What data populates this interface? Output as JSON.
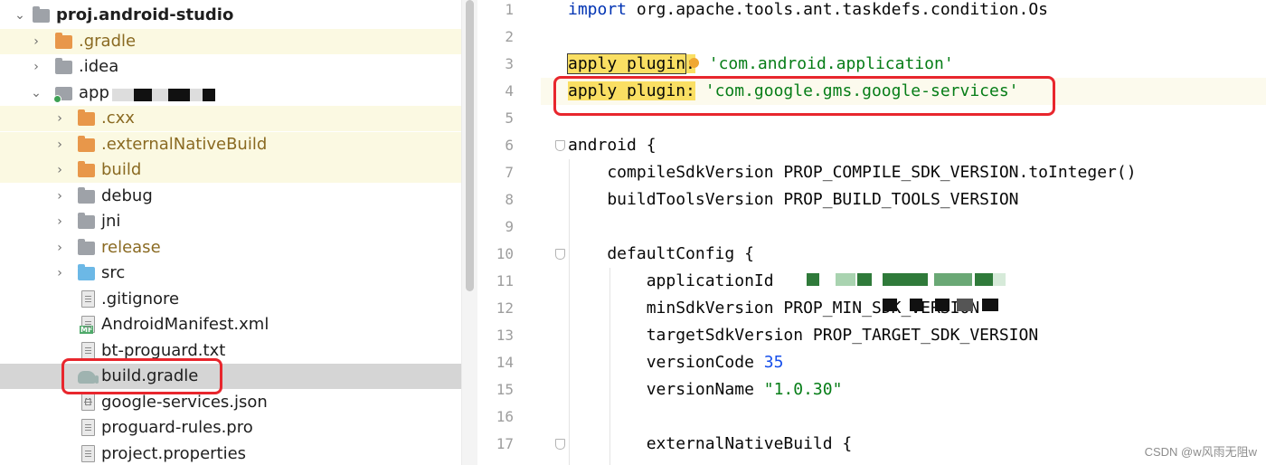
{
  "project_tree": {
    "root": "proj.android-studio",
    "items": [
      {
        "label": ".gradle",
        "expanded": false
      },
      {
        "label": ".idea",
        "expanded": false
      },
      {
        "label": "app",
        "expanded": true
      },
      {
        "label": ".cxx",
        "expanded": false
      },
      {
        "label": ".externalNativeBuild",
        "expanded": false
      },
      {
        "label": "build",
        "expanded": false
      },
      {
        "label": "debug",
        "expanded": false
      },
      {
        "label": "jni",
        "expanded": false
      },
      {
        "label": "release",
        "expanded": false
      },
      {
        "label": "src",
        "expanded": false
      },
      {
        "label": ".gitignore"
      },
      {
        "label": "AndroidManifest.xml",
        "badge": "MF"
      },
      {
        "label": "bt-proguard.txt"
      },
      {
        "label": "build.gradle",
        "selected": true
      },
      {
        "label": "google-services.json",
        "badge": "{}"
      },
      {
        "label": "proguard-rules.pro"
      },
      {
        "label": "project.properties"
      }
    ]
  },
  "editor": {
    "line_numbers": [
      "1",
      "2",
      "3",
      "4",
      "5",
      "6",
      "7",
      "8",
      "9",
      "10",
      "11",
      "12",
      "13",
      "14",
      "15",
      "16",
      "17"
    ],
    "lines": {
      "l1_kw": "import",
      "l1_rest": " org.apache.tools.ant.taskdefs.condition.Os",
      "l3_mark": "apply plugin",
      "l3_colon": ":",
      "l3_str": "'com.android.application'",
      "l4_mark": "apply plugin:",
      "l4_str": "'com.google.gms.google-services'",
      "l6": "android {",
      "l7": "    compileSdkVersion PROP_COMPILE_SDK_VERSION.toInteger()",
      "l8": "    buildToolsVersion PROP_BUILD_TOOLS_VERSION",
      "l10": "    defaultConfig {",
      "l11": "        applicationId",
      "l12": "        minSdkVersion PROP_MIN_SDK_VERSION",
      "l13": "        targetSdkVersion PROP_TARGET_SDK_VERSION",
      "l14_text": "        versionCode ",
      "l14_num": "35",
      "l15_text": "        versionName ",
      "l15_str": "\"1.0.30\"",
      "l17": "        externalNativeBuild {"
    }
  },
  "watermark": "CSDN @w风雨无阻w",
  "colors": {
    "keyword": "#0033b3",
    "string": "#067d17",
    "number": "#1750eb",
    "marker": "#fadf63",
    "annotation_box": "#e8262d"
  },
  "icons": [
    "chevron-right-icon",
    "chevron-down-icon",
    "folder-icon",
    "module-folder-icon",
    "file-icon",
    "gradle-elephant-icon",
    "intention-bulb-icon"
  ]
}
